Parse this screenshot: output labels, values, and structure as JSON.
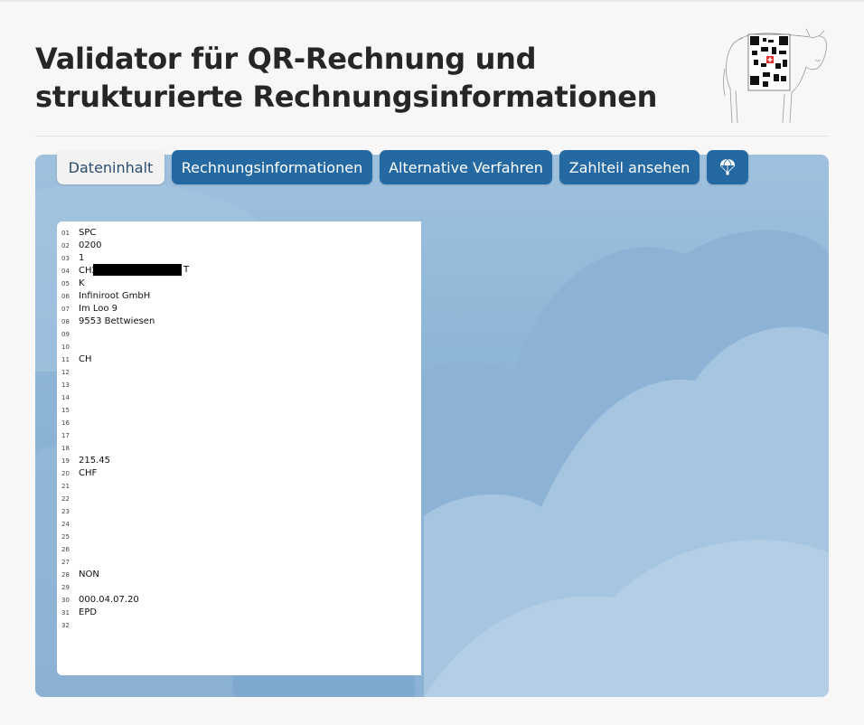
{
  "page": {
    "title_line1": "Validator für QR-Rechnung und",
    "title_line2": "strukturierte Rechnungsinformationen",
    "logo_icon": "cow-with-qr-code-logo"
  },
  "tabs": [
    {
      "label": "Dateninhalt",
      "active": true
    },
    {
      "label": "Rechnungsinformationen",
      "active": false
    },
    {
      "label": "Alternative Verfahren",
      "active": false
    },
    {
      "label": "Zahlteil ansehen",
      "active": false
    },
    {
      "label": "",
      "icon": "parachute-icon",
      "active": false
    }
  ],
  "data_lines": [
    {
      "num": "01",
      "value": "SPC"
    },
    {
      "num": "02",
      "value": "0200"
    },
    {
      "num": "03",
      "value": "1"
    },
    {
      "num": "04",
      "value": "CH2"
    },
    {
      "num": "05",
      "value": "K"
    },
    {
      "num": "06",
      "value": "Infiniroot GmbH"
    },
    {
      "num": "07",
      "value": "Im Loo 9"
    },
    {
      "num": "08",
      "value": "9553 Bettwiesen"
    },
    {
      "num": "09",
      "value": ""
    },
    {
      "num": "10",
      "value": ""
    },
    {
      "num": "11",
      "value": "CH"
    },
    {
      "num": "12",
      "value": ""
    },
    {
      "num": "13",
      "value": ""
    },
    {
      "num": "14",
      "value": ""
    },
    {
      "num": "15",
      "value": ""
    },
    {
      "num": "16",
      "value": ""
    },
    {
      "num": "17",
      "value": ""
    },
    {
      "num": "18",
      "value": ""
    },
    {
      "num": "19",
      "value": "215.45"
    },
    {
      "num": "20",
      "value": "CHF"
    },
    {
      "num": "21",
      "value": ""
    },
    {
      "num": "22",
      "value": ""
    },
    {
      "num": "23",
      "value": ""
    },
    {
      "num": "24",
      "value": ""
    },
    {
      "num": "25",
      "value": ""
    },
    {
      "num": "26",
      "value": ""
    },
    {
      "num": "27",
      "value": ""
    },
    {
      "num": "28",
      "value": "NON"
    },
    {
      "num": "29",
      "value": ""
    },
    {
      "num": "30",
      "value": "000.04.07.20"
    },
    {
      "num": "31",
      "value": "EPD"
    },
    {
      "num": "32",
      "value": ""
    }
  ],
  "iban_suffix": "T",
  "colors": {
    "tab_bg": "#2569a3",
    "tab_active_bg": "#f2f2f2",
    "panel_bg": "#8fb6d7"
  }
}
